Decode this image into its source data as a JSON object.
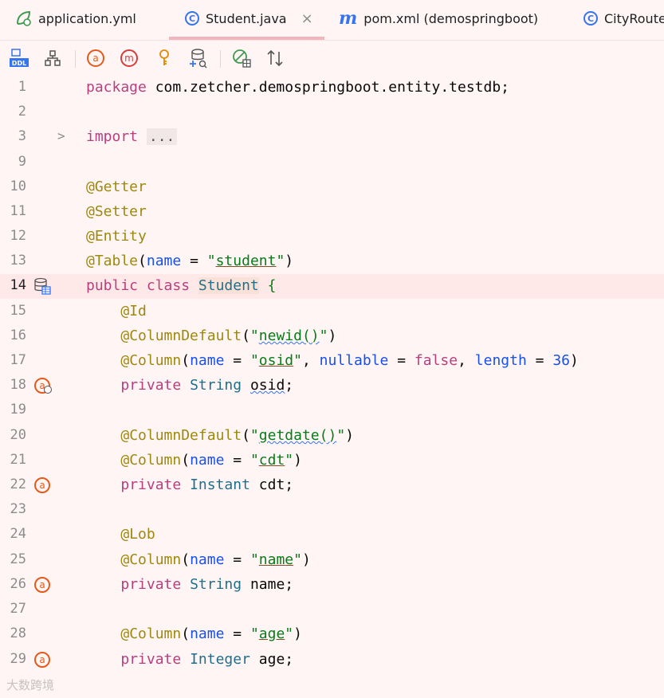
{
  "tabs": [
    {
      "label": "application.yml",
      "icon": "spring-leaf-icon",
      "active": false
    },
    {
      "label": "Student.java",
      "icon": "class-c-icon",
      "active": true,
      "closable": true
    },
    {
      "label": "pom.xml (demospringboot)",
      "icon": "maven-m-icon",
      "active": false
    },
    {
      "label": "CityRoute",
      "icon": "class-c-icon",
      "active": false
    }
  ],
  "close_glyph": "×",
  "toolbar": {
    "ddl_label": "DDL",
    "icons": [
      "ddl-icon",
      "hierarchy-icon",
      "attribute-icon",
      "method-icon",
      "key-icon",
      "add-datasource-icon",
      "toggle-icon",
      "sort-icon"
    ]
  },
  "code": {
    "line_numbers": [
      "1",
      "2",
      "3",
      "9",
      "10",
      "11",
      "12",
      "13",
      "14",
      "15",
      "16",
      "17",
      "18",
      "19",
      "20",
      "21",
      "22",
      "23",
      "24",
      "25",
      "26",
      "27",
      "28",
      "29"
    ],
    "current_line": "14",
    "fold_placeholder": "...",
    "fold_chevron": ">"
  },
  "tokens": {
    "package_kw": "package",
    "package_name": "com.zetcher.demospringboot.entity.testdb;",
    "import_kw": "import",
    "getter": "@Getter",
    "setter": "@Setter",
    "entity": "@Entity",
    "table": "@Table",
    "name_param": "name",
    "eq": " = ",
    "quote": "\"",
    "student_str": "student",
    "public_kw": "public",
    "class_kw": "class",
    "class_name": "Student",
    "open_brace": "{",
    "id_ann": "@Id",
    "col_default": "@ColumnDefault",
    "newid": "newid()",
    "column": "@Column",
    "osid": "osid",
    "nullable": "nullable",
    "false_kw": "false",
    "length": "length",
    "num36": "36",
    "private_kw": "private",
    "string_type": "String",
    "osid_field": "osid",
    "getdate": "getdate()",
    "cdt": "cdt",
    "instant_type": "Instant",
    "lob": "@Lob",
    "name_str": "name",
    "integer_type": "Integer",
    "age": "age"
  },
  "watermark": "大数跨境"
}
